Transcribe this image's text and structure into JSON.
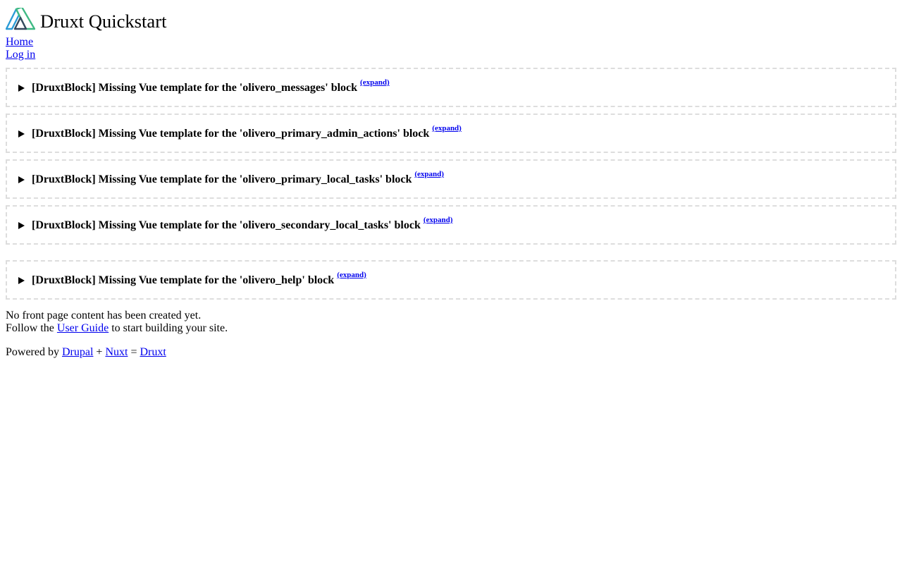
{
  "site": {
    "title": "Druxt Quickstart",
    "logo_icon": "druxt-logo-icon"
  },
  "nav": {
    "items": [
      {
        "label": "Home"
      },
      {
        "label": "Log in"
      }
    ]
  },
  "blocks": [
    {
      "message": "[DruxtBlock] Missing Vue template for the 'olivero_messages' block",
      "expand_label": "(expand)"
    },
    {
      "message": "[DruxtBlock] Missing Vue template for the 'olivero_primary_admin_actions' block",
      "expand_label": "(expand)"
    },
    {
      "message": "[DruxtBlock] Missing Vue template for the 'olivero_primary_local_tasks' block",
      "expand_label": "(expand)"
    },
    {
      "message": "[DruxtBlock] Missing Vue template for the 'olivero_secondary_local_tasks' block",
      "expand_label": "(expand)"
    },
    {
      "message": "[DruxtBlock] Missing Vue template for the 'olivero_help' block",
      "expand_label": "(expand)"
    }
  ],
  "content": {
    "no_content": "No front page content has been created yet.",
    "follow_prefix": "Follow the",
    "user_guide_link": "User Guide",
    "follow_suffix": "to start building your site."
  },
  "footer": {
    "powered_by": "Powered by",
    "drupal_link": "Drupal",
    "plus": "+",
    "nuxt_link": "Nuxt",
    "equals": "=",
    "druxt_link": "Druxt"
  },
  "colors": {
    "link": "#0000ee",
    "logo_green": "#3fb984",
    "logo_blue": "#2b9bd6",
    "logo_dark": "#35495e",
    "block_border": "#dddddd"
  }
}
